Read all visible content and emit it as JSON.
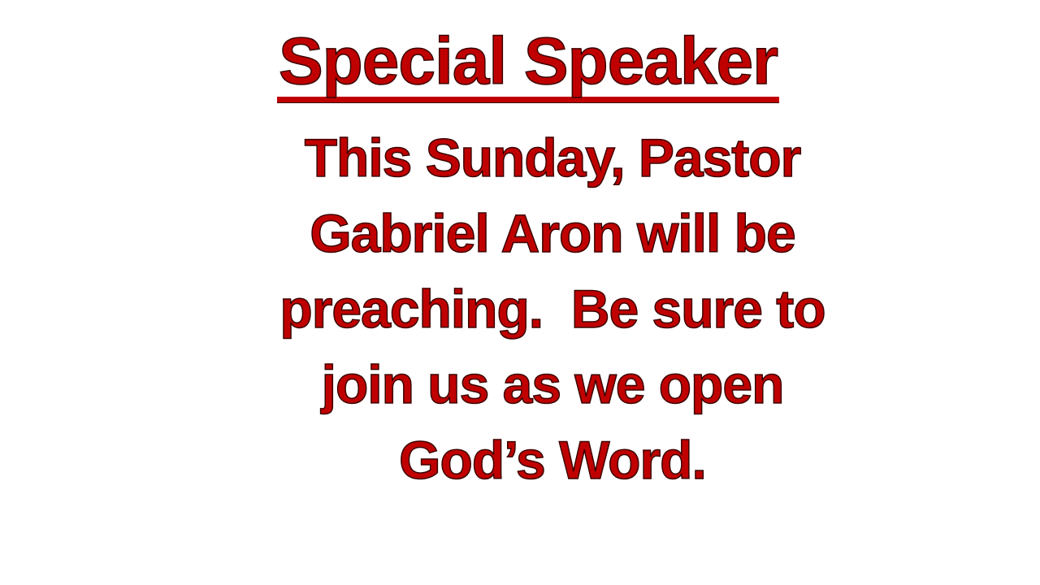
{
  "slide": {
    "title": "Special Speaker",
    "body_lines": [
      "This Sunday, Pastor",
      "Gabriel Aron will be",
      "preaching.  Be sure to",
      "join us as we open",
      "God’s Word."
    ],
    "colors": {
      "text": "#c00000",
      "outline": "#3a0000",
      "background": "#ffffff"
    }
  }
}
